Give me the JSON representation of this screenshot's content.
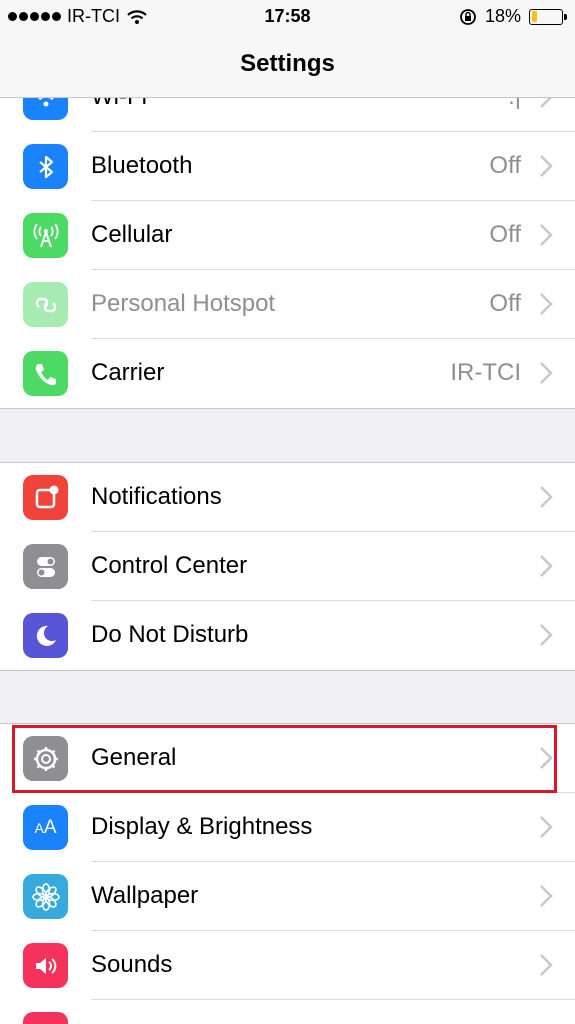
{
  "status_bar": {
    "carrier": "IR-TCI",
    "time": "17:58",
    "battery": "18%",
    "battery_level": 0.18
  },
  "nav": {
    "title": "Settings"
  },
  "rows": [
    {
      "id": "wifi",
      "label": "Wi-Fi",
      "value": "",
      "icon": "wifi-icon",
      "color": "#1a82fb"
    },
    {
      "id": "bluetooth",
      "label": "Bluetooth",
      "value": "Off",
      "icon": "bluetooth-icon",
      "color": "#1a82fb"
    },
    {
      "id": "cellular",
      "label": "Cellular",
      "value": "Off",
      "icon": "cellular-antenna-icon",
      "color": "#4cd964"
    },
    {
      "id": "hotspot",
      "label": "Personal Hotspot",
      "value": "Off",
      "icon": "hotspot-link-icon",
      "color": "#a6ebb1",
      "dimmed": true
    },
    {
      "id": "carrier",
      "label": "Carrier",
      "value": "IR-TCI",
      "icon": "phone-icon",
      "color": "#4cd964"
    },
    {
      "id": "notifications",
      "label": "Notifications",
      "value": "",
      "icon": "notifications-icon",
      "color": "#f0433a"
    },
    {
      "id": "control-center",
      "label": "Control Center",
      "value": "",
      "icon": "toggle-switches-icon",
      "color": "#8e8e93"
    },
    {
      "id": "do-not-disturb",
      "label": "Do Not Disturb",
      "value": "",
      "icon": "moon-icon",
      "color": "#5856d6"
    },
    {
      "id": "general",
      "label": "General",
      "value": "",
      "icon": "gear-icon",
      "color": "#8e8e93",
      "highlighted": true
    },
    {
      "id": "display",
      "label": "Display & Brightness",
      "value": "",
      "icon": "text-size-icon",
      "color": "#1a82fb"
    },
    {
      "id": "wallpaper",
      "label": "Wallpaper",
      "value": "",
      "icon": "flower-icon",
      "color": "#36aadc"
    },
    {
      "id": "sounds",
      "label": "Sounds",
      "value": "",
      "icon": "speaker-icon",
      "color": "#f4325c"
    }
  ]
}
